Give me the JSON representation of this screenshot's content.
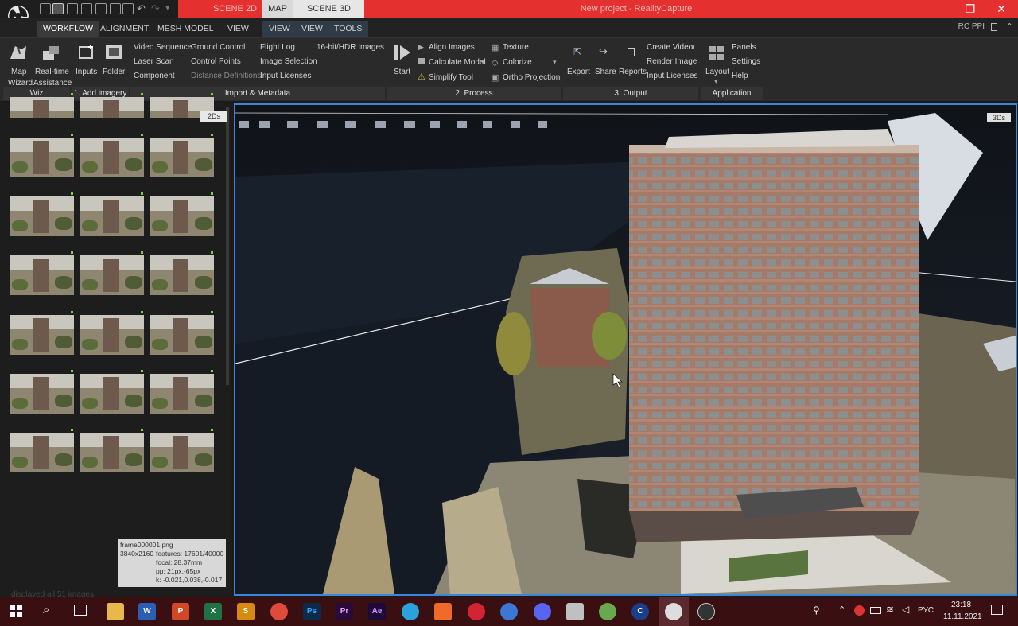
{
  "titlebar": {
    "tabs": {
      "scene2d": "SCENE 2D",
      "map": "MAP",
      "scene3d": "SCENE 3D"
    },
    "window_title": "New project - RealityCapture",
    "controls": {
      "minimize": "—",
      "maximize": "❐",
      "close": "✕"
    }
  },
  "menu": {
    "items": [
      "WORKFLOW",
      "ALIGNMENT",
      "MESH MODEL",
      "VIEW",
      "VIEW",
      "VIEW",
      "TOOLS"
    ],
    "right_label": "RC PPI"
  },
  "ribbon": {
    "wizard": {
      "map_wizard": [
        "Map",
        "Wizard"
      ],
      "realtime": [
        "Real-time",
        "Assistance"
      ]
    },
    "add_imagery": {
      "inputs": "Inputs",
      "folder": "Folder"
    },
    "import": {
      "col1": [
        "Video Sequence",
        "Laser Scan",
        "Component"
      ],
      "col2": [
        "Ground Control",
        "Control Points",
        "Distance Definitions"
      ],
      "col3": [
        "Flight Log",
        "Image Selection",
        "Input Licenses"
      ],
      "col4": "16-bit/HDR Images"
    },
    "process": {
      "start": "Start",
      "col1": [
        "Align Images",
        "Calculate Model",
        "Simplify Tool"
      ],
      "col2": [
        "Texture",
        "Colorize",
        "Ortho Projection"
      ]
    },
    "output": {
      "export": "Export",
      "share": "Share",
      "reports": "Reports",
      "col": [
        "Create Video",
        "Render Image",
        "Input Licenses"
      ]
    },
    "application": {
      "layout": "Layout",
      "col": [
        "Panels",
        "Settings",
        "Help"
      ]
    },
    "groups": [
      "Wiz",
      "1. Add imagery",
      "Import & Metadata",
      "2. Process",
      "3. Output",
      "Application"
    ]
  },
  "left_panel": {
    "badge": "2Ds",
    "displayed": "displayed all 51 images",
    "info": {
      "filename": "frame000001.png",
      "resolution": "3840x2160",
      "features": "features: 17601/40000",
      "focal": "focal: 28.37mm",
      "pp": "pp: 21px,-65px",
      "k": "k: -0.021,0.038,-0.017"
    }
  },
  "viewport": {
    "badge": "3Ds"
  },
  "taskbar": {
    "apps": [
      "W",
      "P",
      "X",
      "S",
      "",
      "Ps",
      "Pr",
      "Ae",
      "",
      "",
      "",
      "",
      "",
      "",
      "",
      "C",
      "",
      ""
    ],
    "lang": "РУС",
    "time": "23:18",
    "date": "11.11.2021"
  }
}
